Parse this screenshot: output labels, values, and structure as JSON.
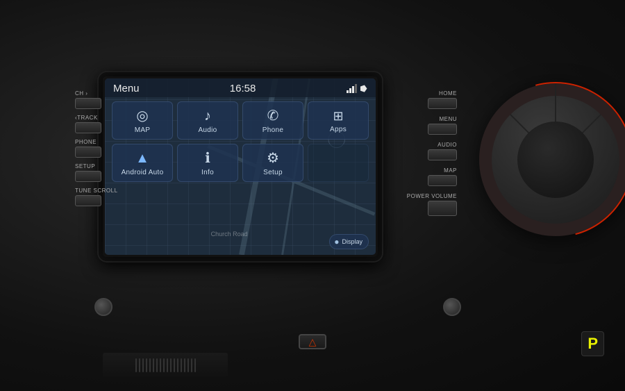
{
  "dashboard": {
    "bg_color": "#1a1a1a"
  },
  "screen": {
    "header": {
      "title": "Menu",
      "clock": "16:58",
      "signal_bars": 3,
      "bluetooth": true
    },
    "menu_row1": [
      {
        "id": "map",
        "label": "MAP",
        "icon": "◎"
      },
      {
        "id": "audio",
        "label": "Audio",
        "icon": "♪"
      },
      {
        "id": "phone",
        "label": "Phone",
        "icon": "✆"
      },
      {
        "id": "apps",
        "label": "Apps",
        "icon": "⊞"
      }
    ],
    "menu_row2": [
      {
        "id": "android_auto",
        "label": "Android Auto",
        "icon": "▲"
      },
      {
        "id": "info",
        "label": "Info",
        "icon": "ℹ"
      },
      {
        "id": "setup",
        "label": "Setup",
        "icon": "⚙"
      }
    ],
    "map_label": "Church Road",
    "display_button": "Display"
  },
  "left_panel": {
    "buttons": [
      {
        "id": "ch",
        "label": "CH ›"
      },
      {
        "id": "track",
        "label": "‹TRACK"
      },
      {
        "id": "phone",
        "label": "PHONE"
      },
      {
        "id": "setup",
        "label": "SETUP"
      },
      {
        "id": "tune_scroll",
        "label": "TUNE\nSCROLL"
      }
    ]
  },
  "right_panel": {
    "buttons": [
      {
        "id": "home",
        "label": "HOME"
      },
      {
        "id": "menu",
        "label": "MENU"
      },
      {
        "id": "audio",
        "label": "AUDIO"
      },
      {
        "id": "map",
        "label": "MAP"
      },
      {
        "id": "power_volume",
        "label": "POWER\nVOLUME"
      }
    ]
  },
  "hazard": {
    "icon": "△"
  },
  "instrument": {
    "gear": "P"
  }
}
